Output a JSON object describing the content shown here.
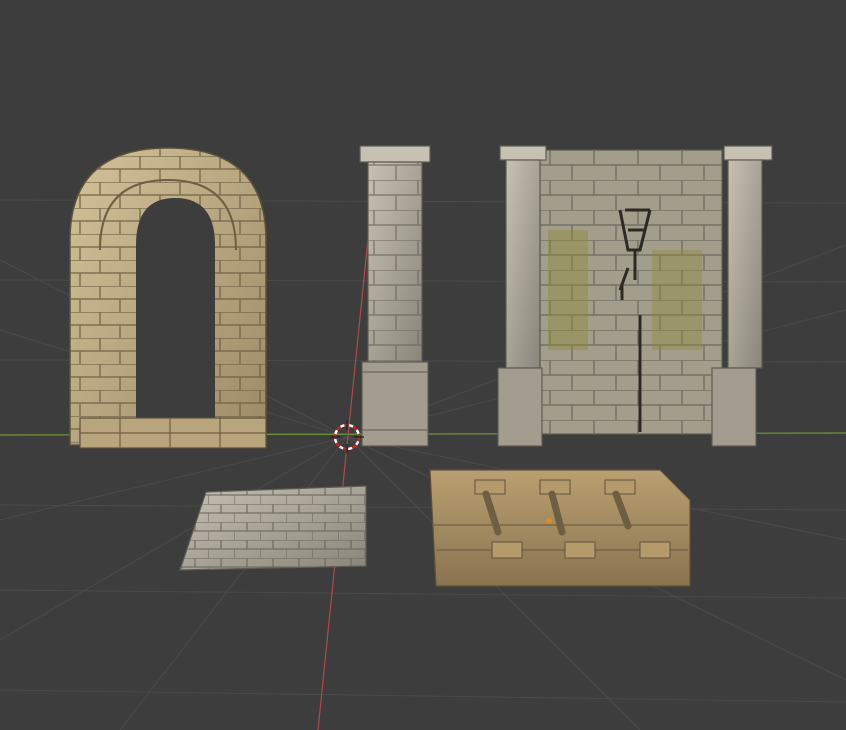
{
  "viewport": {
    "background": "#3d3d3d",
    "grid_color": "#4a4a4a",
    "x_axis_color": "#6b9a3a",
    "y_axis_color": "#b04a4a",
    "cursor_colors": [
      "#ffffff",
      "#d02020"
    ],
    "origin_dot_color": "#e08a20"
  },
  "objects": [
    {
      "name": "stone-arch",
      "material": "sandstone"
    },
    {
      "name": "stone-pillar",
      "material": "grey-stone"
    },
    {
      "name": "stone-wall",
      "material": "mossy-stone",
      "props": [
        "torch-sconce",
        "hanging-chain"
      ]
    },
    {
      "name": "floor-tile",
      "material": "grey-stone"
    },
    {
      "name": "rail-track-tile",
      "material": "sandstone"
    }
  ],
  "colors": {
    "sandstone_light": "#c9b68f",
    "sandstone_dark": "#8a7856",
    "grey_light": "#bdb7aa",
    "grey_dark": "#7d786d",
    "moss": "#8e8a3a",
    "iron": "#2d2a26",
    "rail_brown": "#a98c5e"
  }
}
